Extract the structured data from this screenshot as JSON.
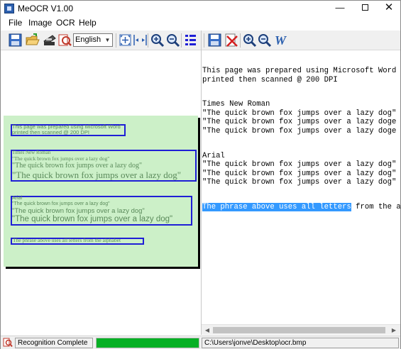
{
  "window": {
    "title": "MeOCR V1.00"
  },
  "menu": {
    "items": [
      "File",
      "Image",
      "OCR",
      "Help"
    ]
  },
  "toolbar": {
    "language": "English",
    "left_icons": [
      "open-image-icon",
      "open-folder-icon",
      "scanner-icon",
      "ocr-recognize-icon",
      "language-select",
      "fit-page-icon",
      "fit-width-icon",
      "zoom-in-icon",
      "zoom-out-icon",
      "text-blocks-icon"
    ],
    "right_icons": [
      "save-text-icon",
      "clear-text-icon",
      "text-zoom-in-icon",
      "text-zoom-out-icon",
      "word-export-icon"
    ]
  },
  "scan": {
    "block1": [
      "This page was prepared using Microsoft Word",
      "printed then scanned @ 200 DPI"
    ],
    "block2_heading": "Times New Roman",
    "block2": [
      "\"The quick brown fox jumps over a lazy dog\"",
      "\"The quick brown fox jumps over a lazy dog\"",
      "\"The quick brown fox jumps over a lazy dog\""
    ],
    "block3_heading": "Arial",
    "block3": [
      "\"The quick brown fox jumps over a lazy dog\"",
      "\"The quick brown fox  jumps over a lazy dog\"",
      "\"The quick brown fox jumps over a lazy dog\""
    ],
    "block4": "The phrase above uses all letters from the alphabet"
  },
  "ocr": {
    "line1": "This page was prepared using Microsoft Word",
    "line2": "printed then scanned @ 200 DPI",
    "line3": "Times New Roman",
    "line4": "\"The quick brown fox jumps over a lazy dog\"",
    "line5": "\"The quick brown fox jumps over a lazy doge",
    "line6": "\"The quick brown fox jumps over a lazy doge",
    "line7": "Arial",
    "line8": "\"The quick brown fox jumps over a lazy dog\"",
    "line9": "\"The quick brown fox jumps over a lazy dog\"",
    "line10": "\"The quick brown fox jumps over a lazy dog\"",
    "line11_selected": "The phrase above uses all letters",
    "line11_rest": " from the alp"
  },
  "status": {
    "message": "Recognition Complete ...",
    "progress_fraction": 1.0,
    "path": "C:\\Users\\jonve\\Desktop\\ocr.bmp"
  },
  "colors": {
    "page_green": "#ccf0c8",
    "bbox_blue": "#1f1fd6",
    "progress_green": "#06b025",
    "selection_blue": "#3399ff"
  }
}
